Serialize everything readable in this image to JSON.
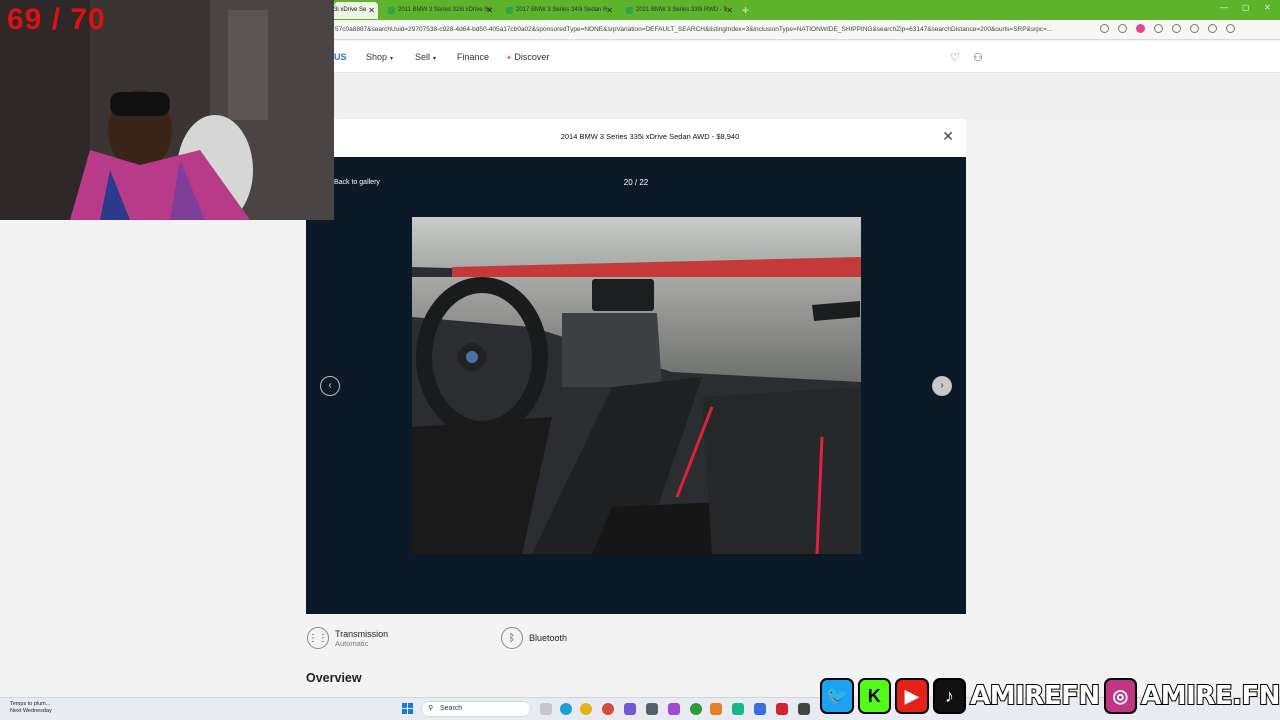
{
  "browser": {
    "tabs": [
      {
        "label": "3i xDrive Se"
      },
      {
        "label": "2011 BMW 3 Series 328i xDrive Se"
      },
      {
        "label": "2017 BMW 3 Series 340i Sedan R"
      },
      {
        "label": "2021 BMW 3 Series 330i RWD - $"
      }
    ],
    "new_tab": "+",
    "url": "57c0a8887&searchUuid=29707538-c928-4d64-bd50-405a17cb0a02&sponsoredType=NONE&srpVariation=DEFAULT_SEARCH&listingIndex=3&inclusionType=NATIONWIDE_SHIPPING&searchZip=63147&searchDistance=200&ourls=SRP&srpc=...",
    "copilot_label": "C"
  },
  "site": {
    "logo": "US",
    "nav": [
      {
        "label": "Shop",
        "has_caret": true
      },
      {
        "label": "Sell",
        "has_caret": true
      },
      {
        "label": "Finance",
        "has_caret": false
      },
      {
        "label": "Discover",
        "has_caret": false
      }
    ]
  },
  "modal": {
    "title": "2014 BMW 3 Series 335i xDrive Sedan AWD - $8,940",
    "back_label": "Back to gallery",
    "counter": "20 / 22",
    "close_icon": "close-icon",
    "prev_icon": "chevron-left-icon",
    "next_icon": "chevron-right-icon"
  },
  "specs": [
    {
      "title": "Transmission",
      "value": "Automatic",
      "icon": "transmission-icon"
    },
    {
      "title": "Bluetooth",
      "value": "",
      "icon": "bluetooth-icon"
    }
  ],
  "overview_heading": "Overview",
  "stream": {
    "counter": "69 / 70",
    "social_handles": [
      "AMIREFN",
      "AMIRE.FN"
    ]
  },
  "taskbar": {
    "weather_line1": "Temps to plum...",
    "weather_line2": "Next Wednesday",
    "search_label": "Search"
  },
  "colors": {
    "tabbar": "#5db32a",
    "modal_bg": "#0b1a26",
    "counter_red": "#e01010",
    "logo_blue": "#2a6fd6"
  }
}
